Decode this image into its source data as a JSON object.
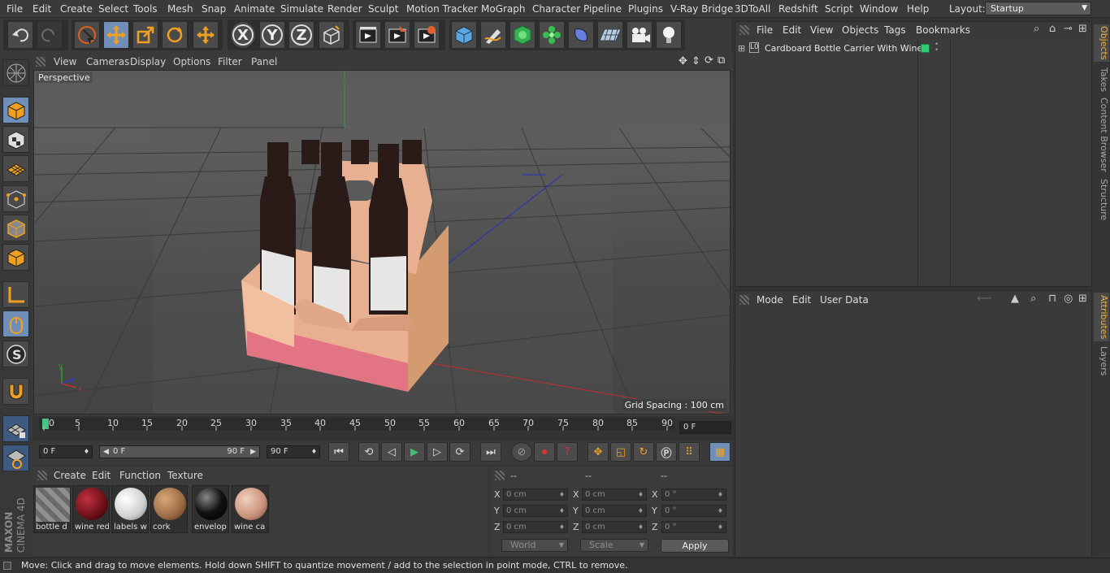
{
  "menubar": {
    "items": [
      "File",
      "Edit",
      "Create",
      "Select",
      "Tools",
      "Mesh",
      "Snap",
      "Animate",
      "Simulate",
      "Render",
      "Sculpt",
      "Motion Tracker",
      "MoGraph",
      "Character",
      "Pipeline",
      "Plugins",
      "V-Ray Bridge",
      "3DToAll",
      "Redshift",
      "Script",
      "Window",
      "Help"
    ],
    "layout_label": "Layout:",
    "layout_value": "Startup"
  },
  "toolbar": {
    "buttons": [
      "undo-icon",
      "redo-icon",
      "live-selection-icon",
      "move-icon",
      "scale-icon",
      "rotate-icon",
      "recent-tools-icon",
      "x-axis-icon",
      "y-axis-icon",
      "z-axis-icon",
      "world-coordinates-icon",
      "render-view-icon",
      "render-picture-viewer-icon",
      "render-settings-icon",
      "cube-icon",
      "pen-icon",
      "subdivision-icon",
      "cloner-icon",
      "deformer-icon",
      "floor-icon",
      "camera-icon",
      "light-icon"
    ],
    "axis_x": "X",
    "axis_y": "Y",
    "axis_z": "Z"
  },
  "viewport": {
    "menu": [
      "View",
      "Cameras",
      "Display",
      "Options",
      "Filter",
      "Panel"
    ],
    "label": "Perspective",
    "grid_spacing": "Grid Spacing : 100 cm"
  },
  "timeline": {
    "ticks": [
      "0",
      "5",
      "10",
      "15",
      "20",
      "25",
      "30",
      "35",
      "40",
      "45",
      "50",
      "55",
      "60",
      "65",
      "70",
      "75",
      "80",
      "85",
      "90"
    ],
    "current_frame": "0 F",
    "start_field": "0 F",
    "range_start": "0 F",
    "range_end": "90 F",
    "end_field": "90 F"
  },
  "materials": {
    "menu": [
      "Create",
      "Edit",
      "Function",
      "Texture"
    ],
    "items": [
      {
        "label": "bottle d",
        "color": "#8a8a8a"
      },
      {
        "label": "wine red",
        "color": "#6a0f16"
      },
      {
        "label": "labels w",
        "color": "#e8e8e8"
      },
      {
        "label": "cork",
        "color": "#9a6a44"
      },
      {
        "label": "envelop",
        "color": "#111111"
      },
      {
        "label": "wine ca",
        "color": "#c9917a"
      }
    ]
  },
  "coords": {
    "headers": [
      "--",
      "--",
      "--"
    ],
    "rows": [
      {
        "axis": "X",
        "pos": "0 cm",
        "size_axis": "X",
        "size": "0 cm",
        "rot_axis": "X",
        "rot": "0 °"
      },
      {
        "axis": "Y",
        "pos": "0 cm",
        "size_axis": "Y",
        "size": "0 cm",
        "rot_axis": "Y",
        "rot": "0 °"
      },
      {
        "axis": "Z",
        "pos": "0 cm",
        "size_axis": "Z",
        "size": "0 cm",
        "rot_axis": "Z",
        "rot": "0 °"
      }
    ],
    "mode": "World",
    "scale": "Scale",
    "apply": "Apply"
  },
  "objects": {
    "menu": [
      "File",
      "Edit",
      "View",
      "Objects",
      "Tags",
      "Bookmarks"
    ],
    "item": "Cardboard Bottle Carrier With Wine",
    "tag_color": "#2ecc71"
  },
  "attributes": {
    "menu": [
      "Mode",
      "Edit",
      "User Data"
    ]
  },
  "right_tabs": [
    "Objects",
    "Takes",
    "Content Browser",
    "Structure",
    "Attributes",
    "Layers"
  ],
  "status": "Move: Click and drag to move elements. Hold down SHIFT to quantize movement / add to the selection in point mode, CTRL to remove.",
  "brand": "MAXON CINEMA 4D"
}
